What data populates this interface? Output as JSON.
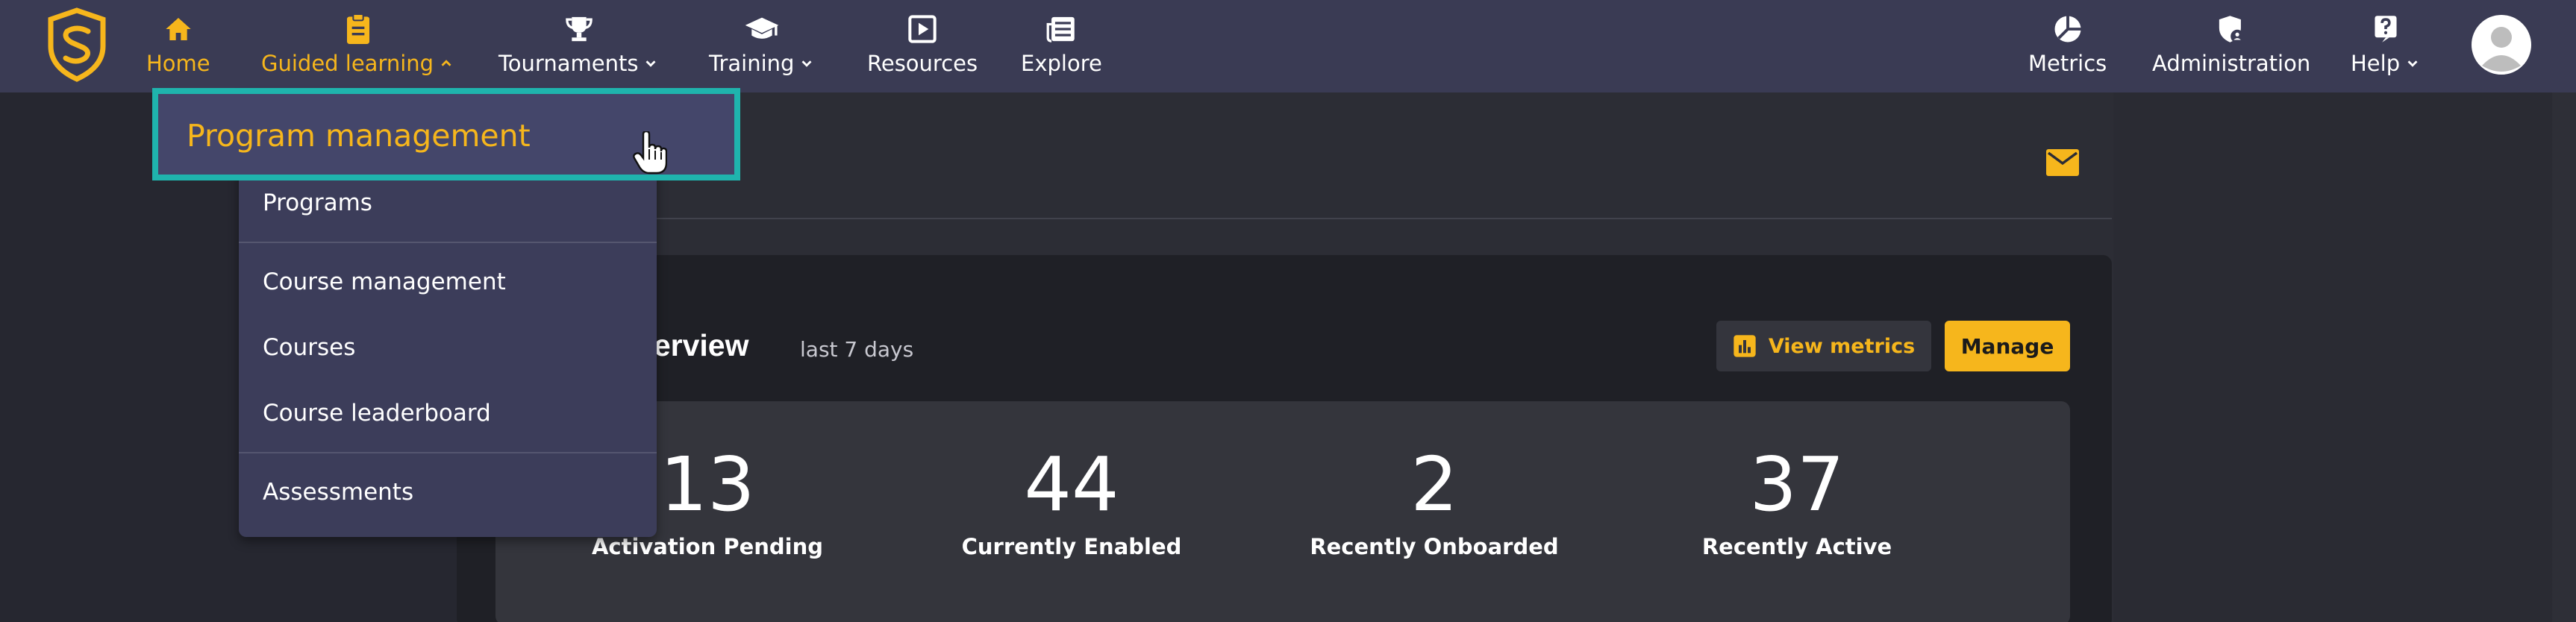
{
  "nav": {
    "left": [
      {
        "label": "Home",
        "icon": "home-icon",
        "active": true
      },
      {
        "label": "Guided learning",
        "icon": "clipboard-icon",
        "active": true,
        "expanded": true
      },
      {
        "label": "Tournaments",
        "icon": "trophy-icon"
      },
      {
        "label": "Training",
        "icon": "graduation-cap-icon"
      },
      {
        "label": "Resources",
        "icon": "play-square-icon"
      },
      {
        "label": "Explore",
        "icon": "newspaper-icon"
      }
    ],
    "right": [
      {
        "label": "Metrics",
        "icon": "pie-chart-icon"
      },
      {
        "label": "Administration",
        "icon": "shield-user-icon"
      },
      {
        "label": "Help",
        "icon": "question-icon"
      }
    ]
  },
  "dropdown": {
    "highlighted": "Program management",
    "items": [
      "Programs",
      "Course management",
      "Courses",
      "Course leaderboard",
      "Assessments"
    ]
  },
  "panel": {
    "title": "overview",
    "subtitle": "last 7 days",
    "view_metrics_label": "View metrics",
    "manage_label": "Manage"
  },
  "stats": [
    {
      "value": "13",
      "label": "Activation Pending"
    },
    {
      "value": "44",
      "label": "Currently Enabled"
    },
    {
      "value": "2",
      "label": "Recently Onboarded"
    },
    {
      "value": "37",
      "label": "Recently Active"
    }
  ],
  "colors": {
    "accent": "#f6b61c",
    "nav_bg": "#3a3b54",
    "highlight_border": "#1fb4ad"
  }
}
